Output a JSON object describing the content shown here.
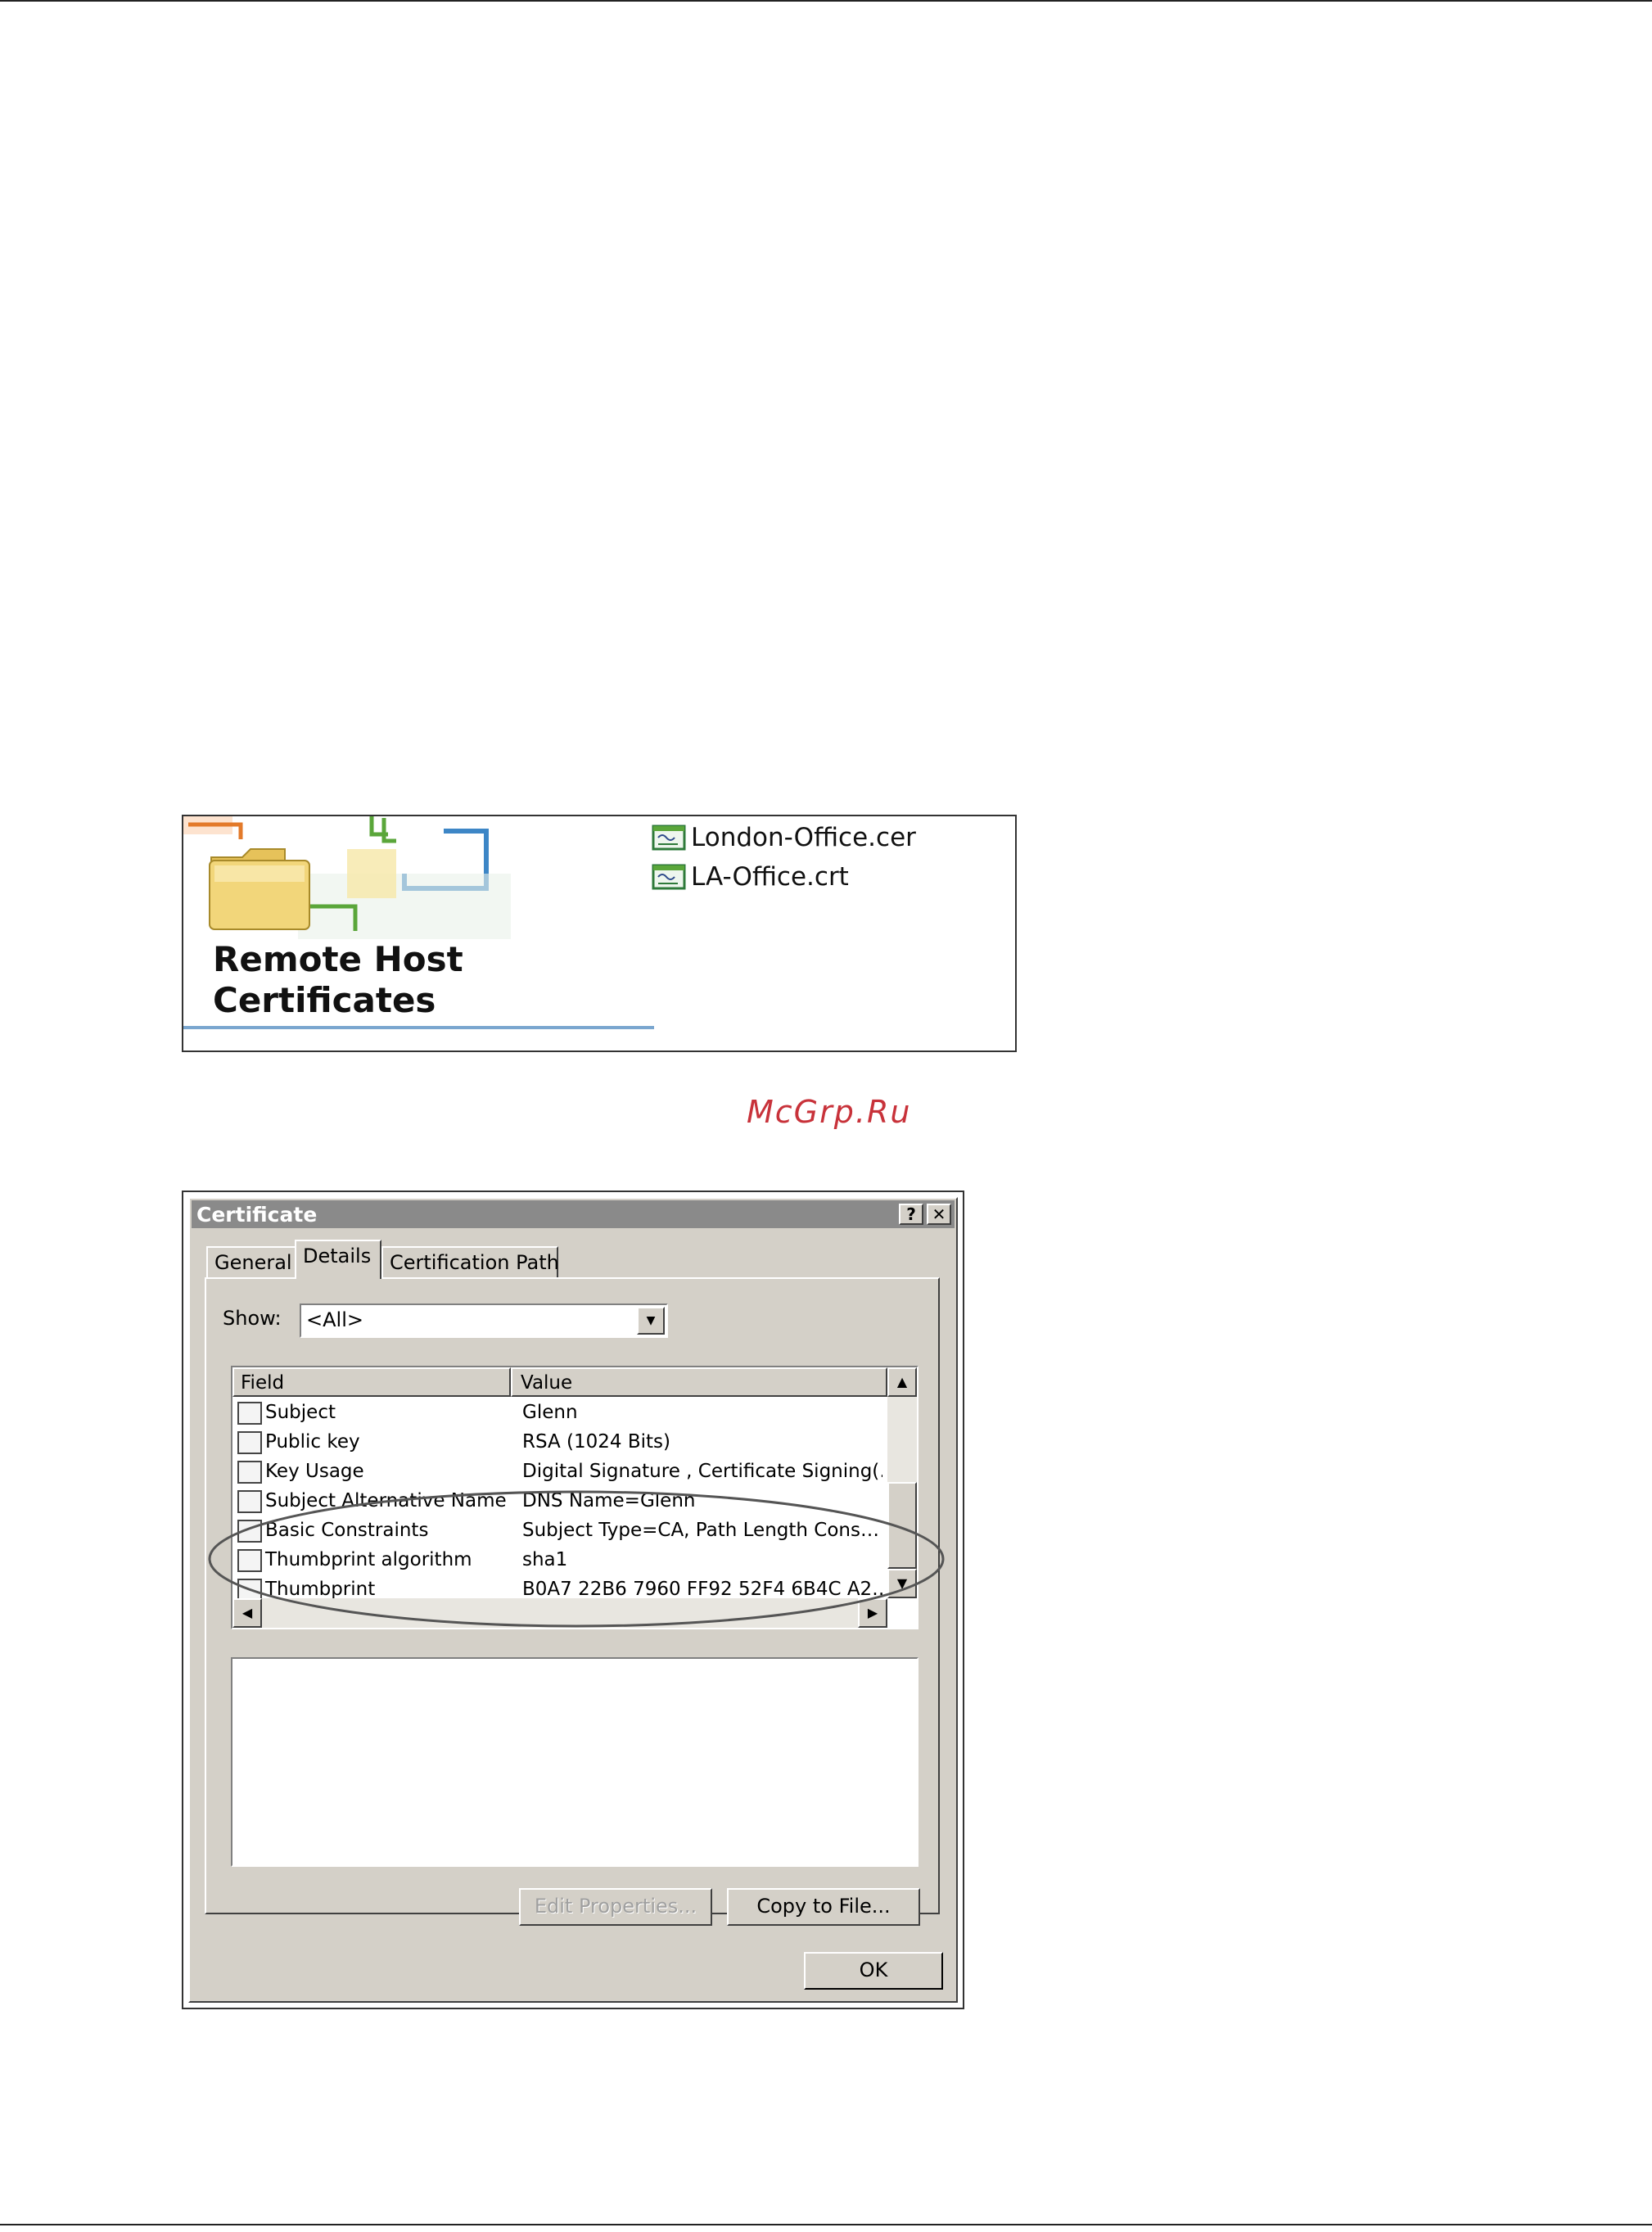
{
  "folder_figure": {
    "title_line1": "Remote Host",
    "title_line2": "Certificates",
    "files": [
      {
        "name": "London-Office.cer",
        "icon": "certificate-file-icon"
      },
      {
        "name": "LA-Office.crt",
        "icon": "certificate-file-icon"
      }
    ]
  },
  "watermark": "McGrp.Ru",
  "dialog": {
    "title": "Certificate",
    "help_label": "?",
    "close_label": "✕",
    "tabs": [
      {
        "label": "General",
        "active": false
      },
      {
        "label": "Details",
        "active": true
      },
      {
        "label": "Certification Path",
        "active": false
      }
    ],
    "show_label": "Show:",
    "show_value": "<All>",
    "columns": {
      "field": "Field",
      "value": "Value"
    },
    "rows": [
      {
        "field": "Subject",
        "value": "Glenn"
      },
      {
        "field": "Public key",
        "value": "RSA (1024 Bits)"
      },
      {
        "field": "Key Usage",
        "value": "Digital Signature , Certificate Signing(…"
      },
      {
        "field": "Subject Alternative Name",
        "value": "DNS Name=Glenn"
      },
      {
        "field": "Basic Constraints",
        "value": "Subject Type=CA, Path Length Cons…"
      },
      {
        "field": "Thumbprint algorithm",
        "value": "sha1"
      },
      {
        "field": "Thumbprint",
        "value": "B0A7 22B6 7960 FF92 52F4 6B4C A2…"
      }
    ],
    "edit_properties_label": "Edit Properties...",
    "copy_to_file_label": "Copy to File...",
    "ok_label": "OK"
  },
  "colors": {
    "dialog_face": "#d4d0c8",
    "title_bar": "#8a8a8a",
    "watermark": "#c8323a",
    "folder": "#f2d67a",
    "accent_blue": "#3d86c6",
    "accent_orange": "#e37a2a",
    "accent_green": "#5aa63a"
  }
}
